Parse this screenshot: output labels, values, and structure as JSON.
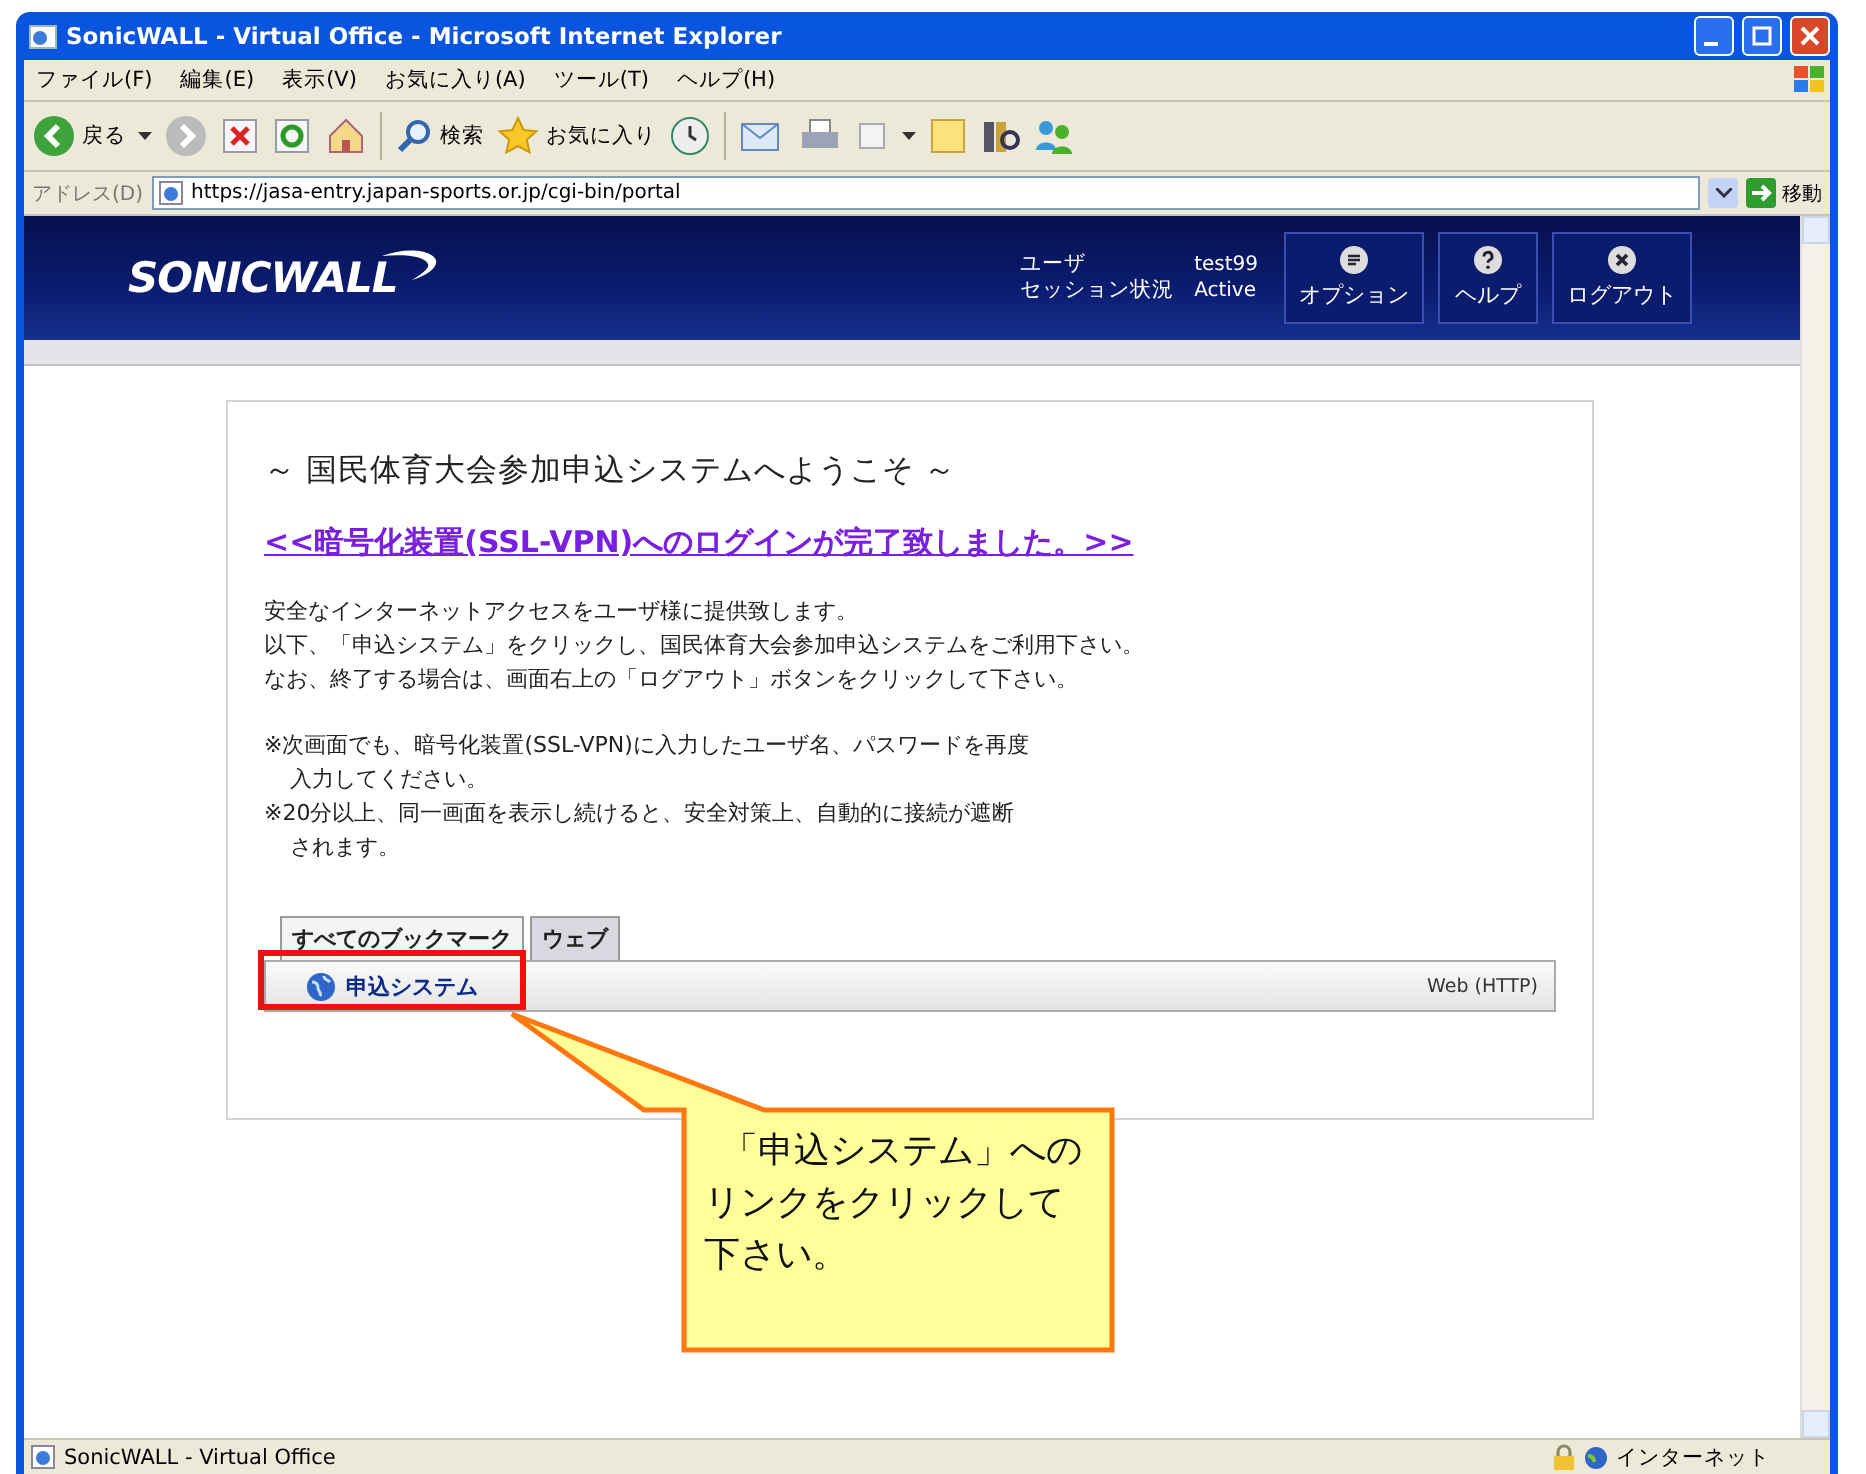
{
  "window": {
    "title": "SonicWALL - Virtual Office - Microsoft Internet Explorer"
  },
  "menu": [
    "ファイル(F)",
    "編集(E)",
    "表示(V)",
    "お気に入り(A)",
    "ツール(T)",
    "ヘルプ(H)"
  ],
  "toolbar": {
    "back": "戻る",
    "search": "検索",
    "favorites": "お気に入り"
  },
  "address_bar": {
    "label": "アドレス(D)",
    "url": "https://jasa-entry.japan-sports.or.jp/cgi-bin/portal",
    "go": "移動"
  },
  "header": {
    "logo": "SONICWALL",
    "user_label": "ユーザ",
    "user": "test99",
    "session_label": "セッション状況",
    "session": "Active",
    "buttons": [
      {
        "label": "オプション",
        "kind": "options"
      },
      {
        "label": "ヘルプ",
        "kind": "help"
      },
      {
        "label": "ログアウト",
        "kind": "logout"
      }
    ]
  },
  "portal": {
    "heading": "～ 国民体育大会参加申込システムへようこそ ～",
    "login_link": "<<暗号化装置(SSL-VPN)へのログインが完了致しました。>>",
    "intro": [
      "安全なインターネットアクセスをユーザ様に提供致します。",
      "以下、「申込システム」をクリックし、国民体育大会参加申込システムをご利用下さい。",
      "なお、終了する場合は、画面右上の「ログアウト」ボタンをクリックして下さい。"
    ],
    "notes": [
      {
        "lines": [
          "※次画面でも、暗号化装置(SSL-VPN)に入力したユーザ名、パスワードを再度",
          "入力してください。"
        ]
      },
      {
        "lines": [
          "※20分以上、同一画面を表示し続けると、安全対策上、自動的に接続が遮断",
          "されます。"
        ]
      }
    ]
  },
  "bookmarks": {
    "tabs": [
      {
        "label": "すべてのブックマーク",
        "selected": true
      },
      {
        "label": "ウェブ",
        "selected": false
      }
    ],
    "items": [
      {
        "name": "申込システム",
        "type": "Web (HTTP)",
        "highlighted": true
      }
    ]
  },
  "callout": {
    "text": "「申込システム」へのリンクをクリックして下さい。"
  },
  "status_bar": {
    "text": "SonicWALL - Virtual Office",
    "zone": "インターネット"
  }
}
